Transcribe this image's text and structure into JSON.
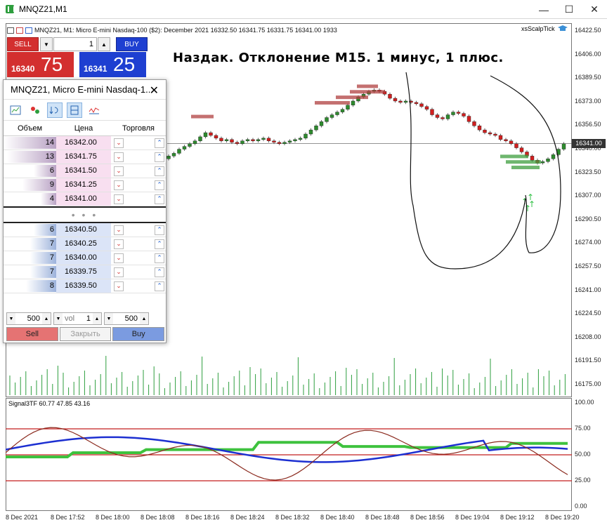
{
  "window": {
    "title": "MNQZ21,M1",
    "minimize": "—",
    "maximize": "☐",
    "close": "✕"
  },
  "chart_header": {
    "symbol_tf": "MNQZ21, M1:",
    "description": "Micro E-mini Nasdaq-100 ($2): December 2021",
    "ohlc": "16332.50 16341.75 16331.75 16341.00",
    "volume": "1933",
    "expert": "xsScalpTick"
  },
  "annotation": "Наздак. Отклонение М15. 1 минус, 1 плюс.",
  "one_click": {
    "sell_label": "SELL",
    "buy_label": "BUY",
    "lot": "1",
    "sell_small": "16340",
    "sell_big": "75",
    "buy_small": "16341",
    "buy_big": "25"
  },
  "dom": {
    "title": "MNQZ21, Micro E-mini Nasdaq-1...",
    "close": "✕",
    "headers": {
      "volume": "Объем",
      "price": "Цена",
      "trade": "Торговля"
    },
    "asks": [
      {
        "vol": "14",
        "price": "16342.00",
        "fill": 1.0
      },
      {
        "vol": "13",
        "price": "16341.75",
        "fill": 0.93
      },
      {
        "vol": "6",
        "price": "16341.50",
        "fill": 0.43
      },
      {
        "vol": "9",
        "price": "16341.25",
        "fill": 0.64
      },
      {
        "vol": "4",
        "price": "16341.00",
        "fill": 0.29
      }
    ],
    "separator": "• • •",
    "bids": [
      {
        "vol": "6",
        "price": "16340.50",
        "fill": 0.43
      },
      {
        "vol": "7",
        "price": "16340.25",
        "fill": 0.5
      },
      {
        "vol": "7",
        "price": "16340.00",
        "fill": 0.5
      },
      {
        "vol": "7",
        "price": "16339.75",
        "fill": 0.5
      },
      {
        "vol": "8",
        "price": "16339.50",
        "fill": 0.57
      }
    ],
    "controls": {
      "left_value": "500",
      "vol_placeholder": "vol",
      "vol_value": "1",
      "right_value": "500"
    },
    "actions": {
      "sell": "Sell",
      "close": "Закрыть",
      "buy": "Buy"
    }
  },
  "price_axis": {
    "ticks": [
      "16422.50",
      "16406.00",
      "16389.50",
      "16373.00",
      "16356.50",
      "16340.00",
      "16323.50",
      "16307.00",
      "16290.50",
      "16274.00",
      "16257.50",
      "16241.00",
      "16224.50",
      "16208.00",
      "16191.50",
      "16175.00"
    ],
    "current": "16341.00"
  },
  "indicator": {
    "label": "Signal3TF 60.77 47.85 43.16",
    "ticks": [
      "100.00",
      "75.00",
      "50.00",
      "25.00",
      "0.00"
    ]
  },
  "time_axis": [
    "8 Dec 2021",
    "8 Dec 17:52",
    "8 Dec 18:00",
    "8 Dec 18:08",
    "8 Dec 18:16",
    "8 Dec 18:24",
    "8 Dec 18:32",
    "8 Dec 18:40",
    "8 Dec 18:48",
    "8 Dec 18:56",
    "8 Dec 19:04",
    "8 Dec 19:12",
    "8 Dec 19:20"
  ],
  "colors": {
    "sell": "#d32f2f",
    "buy": "#1e3fd1",
    "bull": "#2e8b2e",
    "bear": "#d11f1f"
  }
}
